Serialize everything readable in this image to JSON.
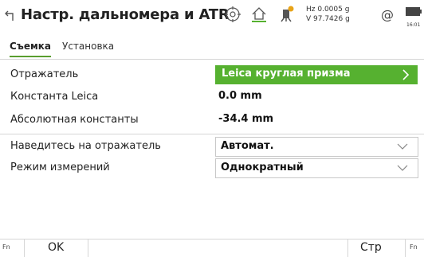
{
  "titlebar": {
    "title": "Настр. дальномера и ATR",
    "hz": "Hz 0.0005 g",
    "v": "V 97.7426 g",
    "at_symbol": "@",
    "time": "16:01"
  },
  "tabs": [
    {
      "label": "Съемка",
      "active": true
    },
    {
      "label": "Установка",
      "active": false
    }
  ],
  "fields": {
    "reflector": {
      "label": "Отражатель",
      "value": "Leica круглая призма"
    },
    "leica_constant": {
      "label": "Константа Leica",
      "value": "0.0 mm"
    },
    "absolute_constant": {
      "label": "Абсолютная константы",
      "value": "-34.4 mm"
    },
    "aim_at_reflector": {
      "label": "Наведитесь на отражатель",
      "value": "Автомат."
    },
    "measure_mode": {
      "label": "Режим измерений",
      "value": "Однократный"
    }
  },
  "softkeys": {
    "fn_left": "Fn",
    "ok": "OK",
    "page": "Стр",
    "fn_right": "Fn"
  },
  "colors": {
    "accent_green": "#56b130",
    "tab_underline": "#5a9e2f"
  }
}
